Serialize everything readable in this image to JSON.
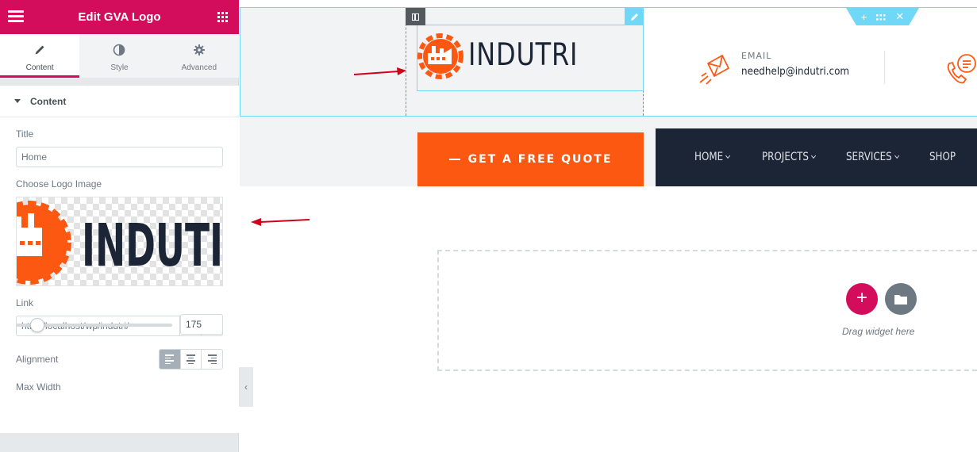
{
  "panel": {
    "title": "Edit GVA Logo",
    "tabs": [
      {
        "label": "Content",
        "icon": "pencil-icon"
      },
      {
        "label": "Style",
        "icon": "half-circle-icon"
      },
      {
        "label": "Advanced",
        "icon": "gear-icon"
      }
    ],
    "section_title": "Content",
    "fields": {
      "title_label": "Title",
      "title_value": "Home",
      "logo_image_label": "Choose Logo Image",
      "logo_image_text": "INDUTI",
      "link_label": "Link",
      "link_value": "http://localhost/wp/indutri/",
      "alignment_label": "Alignment",
      "alignment_selected": "left",
      "max_width_label": "Max Width",
      "max_width_value": "175",
      "max_width_slider_fraction": 0.14
    }
  },
  "canvas": {
    "logo_text": "INDUTRI",
    "email_label": "EMAIL",
    "email_value": "needhelp@indutri.com",
    "quote_button": "GET A FREE QUOTE",
    "nav": [
      {
        "label": "HOME",
        "has_dropdown": true
      },
      {
        "label": "PROJECTS",
        "has_dropdown": true
      },
      {
        "label": "SERVICES",
        "has_dropdown": true
      },
      {
        "label": "SHOP",
        "has_dropdown": false
      }
    ],
    "drop_zone_text": "Drag widget here"
  },
  "colors": {
    "brand": "#d30c5c",
    "orange": "#fd5812",
    "navy": "#1b2536",
    "editor_blue": "#71d7f7",
    "annotation_red": "#d0021b"
  }
}
